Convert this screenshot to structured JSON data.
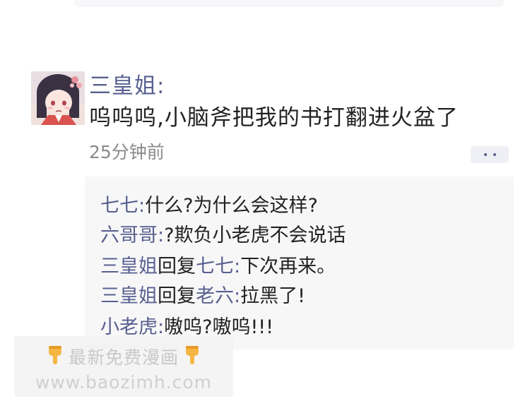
{
  "comment": {
    "author": "三皇姐:",
    "text": "呜呜呜,小脑斧把我的书打翻进火盆了",
    "time": "25分钟前"
  },
  "replies": [
    {
      "name": "七七",
      "sep": ":",
      "text": "什么?为什么会这样?"
    },
    {
      "name": "六哥哥",
      "sep": ":",
      "text": "?欺负小老虎不会说话"
    },
    {
      "name": "三皇姐",
      "mid": "回复",
      "target": "七七",
      "sep": ":",
      "text": "下次再来。"
    },
    {
      "name": "三皇姐",
      "mid": "回复",
      "target": "老六",
      "sep": ":",
      "text": "拉黑了!"
    },
    {
      "name": "小老虎",
      "sep": ":",
      "text": "嗷呜?嗷呜!!!"
    }
  ],
  "watermark": {
    "line1": "最新免费漫画",
    "line2": "www.baozimh.com",
    "icon": "pointing-down-hand-icon"
  },
  "colors": {
    "name": "#58608f",
    "text": "#222222",
    "time": "#8a8a8a",
    "reply_bg": "#f7f7f8"
  }
}
